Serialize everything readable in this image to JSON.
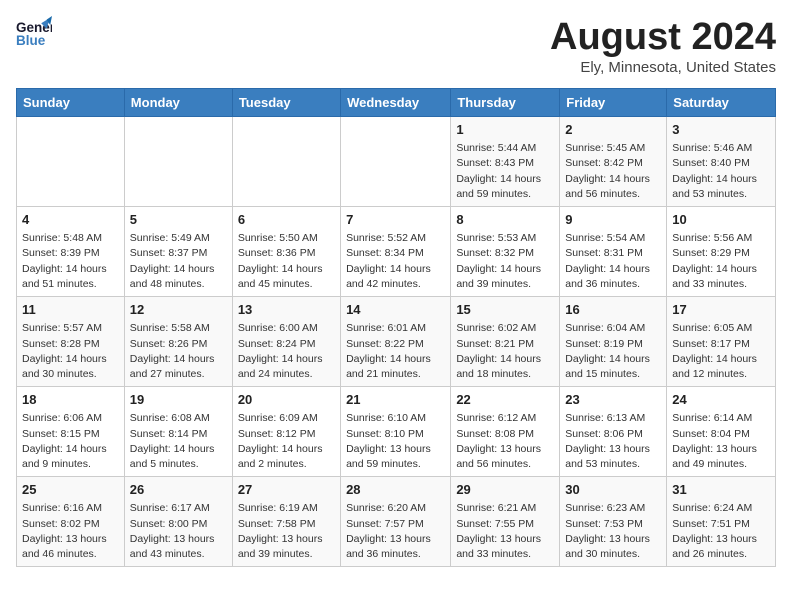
{
  "header": {
    "logo_general": "General",
    "logo_blue": "Blue",
    "month_year": "August 2024",
    "location": "Ely, Minnesota, United States"
  },
  "weekdays": [
    "Sunday",
    "Monday",
    "Tuesday",
    "Wednesday",
    "Thursday",
    "Friday",
    "Saturday"
  ],
  "weeks": [
    [
      {
        "day": "",
        "info": ""
      },
      {
        "day": "",
        "info": ""
      },
      {
        "day": "",
        "info": ""
      },
      {
        "day": "",
        "info": ""
      },
      {
        "day": "1",
        "info": "Sunrise: 5:44 AM\nSunset: 8:43 PM\nDaylight: 14 hours\nand 59 minutes."
      },
      {
        "day": "2",
        "info": "Sunrise: 5:45 AM\nSunset: 8:42 PM\nDaylight: 14 hours\nand 56 minutes."
      },
      {
        "day": "3",
        "info": "Sunrise: 5:46 AM\nSunset: 8:40 PM\nDaylight: 14 hours\nand 53 minutes."
      }
    ],
    [
      {
        "day": "4",
        "info": "Sunrise: 5:48 AM\nSunset: 8:39 PM\nDaylight: 14 hours\nand 51 minutes."
      },
      {
        "day": "5",
        "info": "Sunrise: 5:49 AM\nSunset: 8:37 PM\nDaylight: 14 hours\nand 48 minutes."
      },
      {
        "day": "6",
        "info": "Sunrise: 5:50 AM\nSunset: 8:36 PM\nDaylight: 14 hours\nand 45 minutes."
      },
      {
        "day": "7",
        "info": "Sunrise: 5:52 AM\nSunset: 8:34 PM\nDaylight: 14 hours\nand 42 minutes."
      },
      {
        "day": "8",
        "info": "Sunrise: 5:53 AM\nSunset: 8:32 PM\nDaylight: 14 hours\nand 39 minutes."
      },
      {
        "day": "9",
        "info": "Sunrise: 5:54 AM\nSunset: 8:31 PM\nDaylight: 14 hours\nand 36 minutes."
      },
      {
        "day": "10",
        "info": "Sunrise: 5:56 AM\nSunset: 8:29 PM\nDaylight: 14 hours\nand 33 minutes."
      }
    ],
    [
      {
        "day": "11",
        "info": "Sunrise: 5:57 AM\nSunset: 8:28 PM\nDaylight: 14 hours\nand 30 minutes."
      },
      {
        "day": "12",
        "info": "Sunrise: 5:58 AM\nSunset: 8:26 PM\nDaylight: 14 hours\nand 27 minutes."
      },
      {
        "day": "13",
        "info": "Sunrise: 6:00 AM\nSunset: 8:24 PM\nDaylight: 14 hours\nand 24 minutes."
      },
      {
        "day": "14",
        "info": "Sunrise: 6:01 AM\nSunset: 8:22 PM\nDaylight: 14 hours\nand 21 minutes."
      },
      {
        "day": "15",
        "info": "Sunrise: 6:02 AM\nSunset: 8:21 PM\nDaylight: 14 hours\nand 18 minutes."
      },
      {
        "day": "16",
        "info": "Sunrise: 6:04 AM\nSunset: 8:19 PM\nDaylight: 14 hours\nand 15 minutes."
      },
      {
        "day": "17",
        "info": "Sunrise: 6:05 AM\nSunset: 8:17 PM\nDaylight: 14 hours\nand 12 minutes."
      }
    ],
    [
      {
        "day": "18",
        "info": "Sunrise: 6:06 AM\nSunset: 8:15 PM\nDaylight: 14 hours\nand 9 minutes."
      },
      {
        "day": "19",
        "info": "Sunrise: 6:08 AM\nSunset: 8:14 PM\nDaylight: 14 hours\nand 5 minutes."
      },
      {
        "day": "20",
        "info": "Sunrise: 6:09 AM\nSunset: 8:12 PM\nDaylight: 14 hours\nand 2 minutes."
      },
      {
        "day": "21",
        "info": "Sunrise: 6:10 AM\nSunset: 8:10 PM\nDaylight: 13 hours\nand 59 minutes."
      },
      {
        "day": "22",
        "info": "Sunrise: 6:12 AM\nSunset: 8:08 PM\nDaylight: 13 hours\nand 56 minutes."
      },
      {
        "day": "23",
        "info": "Sunrise: 6:13 AM\nSunset: 8:06 PM\nDaylight: 13 hours\nand 53 minutes."
      },
      {
        "day": "24",
        "info": "Sunrise: 6:14 AM\nSunset: 8:04 PM\nDaylight: 13 hours\nand 49 minutes."
      }
    ],
    [
      {
        "day": "25",
        "info": "Sunrise: 6:16 AM\nSunset: 8:02 PM\nDaylight: 13 hours\nand 46 minutes."
      },
      {
        "day": "26",
        "info": "Sunrise: 6:17 AM\nSunset: 8:00 PM\nDaylight: 13 hours\nand 43 minutes."
      },
      {
        "day": "27",
        "info": "Sunrise: 6:19 AM\nSunset: 7:58 PM\nDaylight: 13 hours\nand 39 minutes."
      },
      {
        "day": "28",
        "info": "Sunrise: 6:20 AM\nSunset: 7:57 PM\nDaylight: 13 hours\nand 36 minutes."
      },
      {
        "day": "29",
        "info": "Sunrise: 6:21 AM\nSunset: 7:55 PM\nDaylight: 13 hours\nand 33 minutes."
      },
      {
        "day": "30",
        "info": "Sunrise: 6:23 AM\nSunset: 7:53 PM\nDaylight: 13 hours\nand 30 minutes."
      },
      {
        "day": "31",
        "info": "Sunrise: 6:24 AM\nSunset: 7:51 PM\nDaylight: 13 hours\nand 26 minutes."
      }
    ]
  ]
}
